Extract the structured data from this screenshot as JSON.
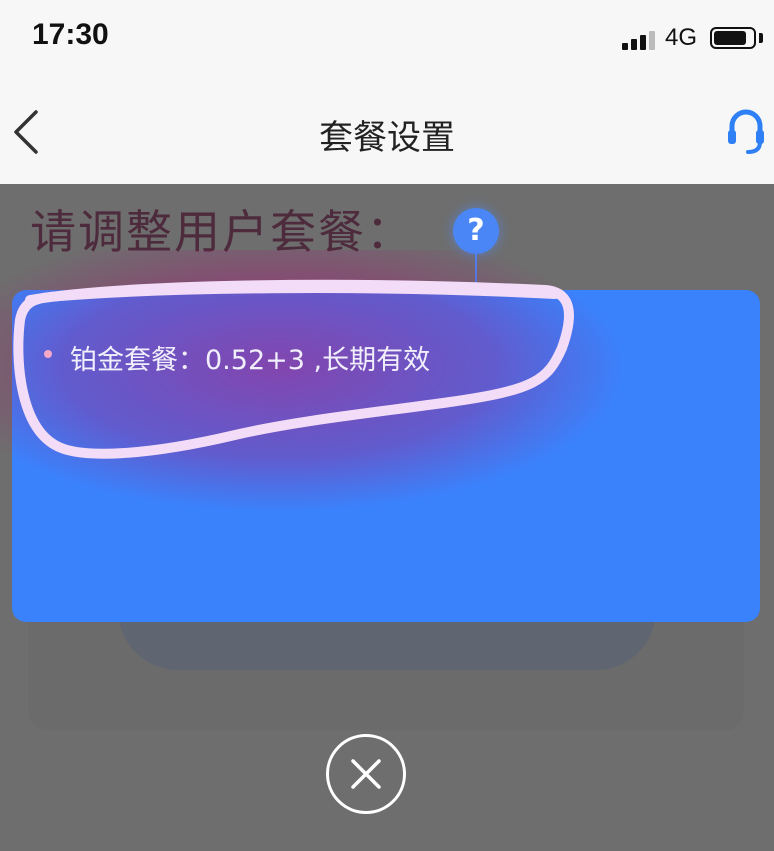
{
  "status_bar": {
    "time": "17:30",
    "network": "4G",
    "signal_bars": 3,
    "battery_level": 0.85
  },
  "nav": {
    "title": "套餐设置",
    "back_icon": "chevron-left-icon",
    "support_icon": "headset-icon"
  },
  "page": {
    "heading": "请调整用户套餐：",
    "help_label": "?"
  },
  "popup": {
    "item": "铂金套餐：0.52+3 ,长期有效"
  },
  "colors": {
    "accent": "#3a82fc",
    "highlight": "#f0d8f5",
    "overlay": "#707070"
  },
  "close_icon": "close-icon"
}
